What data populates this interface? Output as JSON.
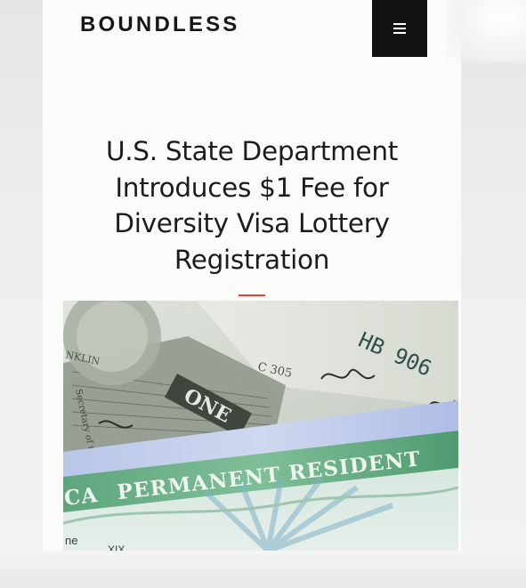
{
  "header": {
    "logo_text": "BOUNDLESS",
    "menu_icon": "hamburger-menu-icon"
  },
  "article": {
    "title_lines": [
      "U.S. State Department",
      "Introduces $1 Fee for",
      "Diversity Visa Lottery",
      "Registration"
    ],
    "accent_color": "#e0443c"
  },
  "hero_image": {
    "card_text": "PERMANENT RESIDENT",
    "card_prefix": "CA",
    "bill_serial": "HB 906",
    "bill_word": "ONE",
    "bill_plate": "C 305",
    "bill_fragment": "NKLIN",
    "bill_signature_label": "Secretary of th",
    "card_fragment_1": "ne",
    "card_fragment_2": "XIX"
  }
}
